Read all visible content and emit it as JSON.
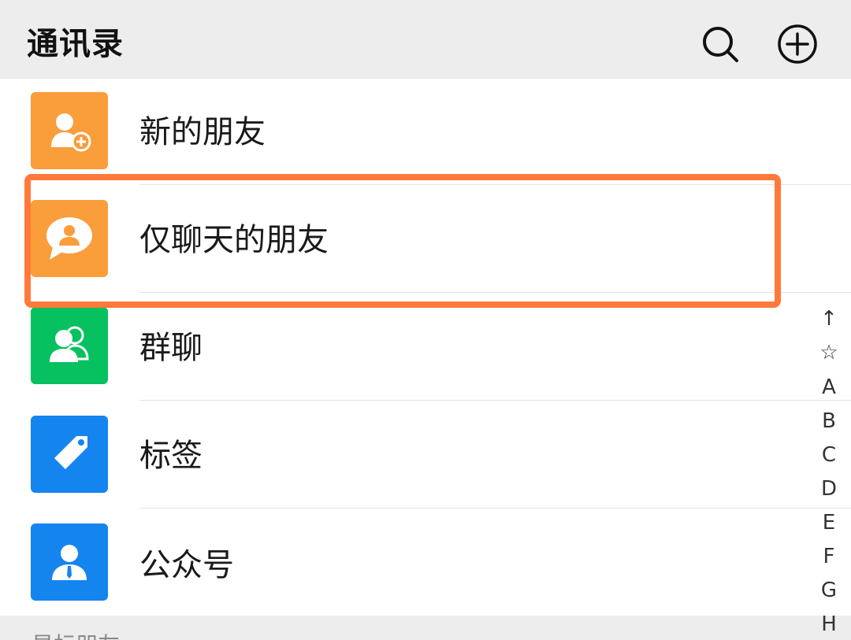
{
  "header": {
    "title": "通讯录",
    "search_icon": "search-icon",
    "add_icon": "plus-circle-icon"
  },
  "rows": [
    {
      "label": "新的朋友",
      "icon": "new-friend-icon",
      "color": "#fa9d3b"
    },
    {
      "label": "仅聊天的朋友",
      "icon": "chat-only-friend-icon",
      "color": "#fa9d3b"
    },
    {
      "label": "群聊",
      "icon": "group-chat-icon",
      "color": "#07c160"
    },
    {
      "label": "标签",
      "icon": "tag-icon",
      "color": "#1485ee"
    },
    {
      "label": "公众号",
      "icon": "official-account-icon",
      "color": "#1485ee"
    }
  ],
  "section_header": "星标朋友",
  "index_bar": [
    "↑",
    "☆",
    "A",
    "B",
    "C",
    "D",
    "E",
    "F",
    "G",
    "H"
  ],
  "colors": {
    "header_bg": "#ededed",
    "highlight": "#ff7a3a",
    "text": "#1a1a1a"
  }
}
